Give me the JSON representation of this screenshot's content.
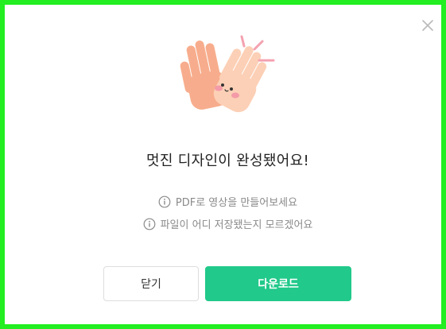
{
  "dialog": {
    "title": "멋진 디자인이 완성됐어요!",
    "tips": [
      "PDF로 영상을 만들어보세요",
      "파일이 어디 저장됐는지 모르겠어요"
    ],
    "buttons": {
      "close_label": "닫기",
      "download_label": "다운로드"
    },
    "icons": {
      "close": "close-icon",
      "illustration": "high-five-hands-illustration",
      "tip": "info-icon"
    },
    "colors": {
      "frame_border": "#22ee22",
      "primary": "#21c98a",
      "hand_back": "#f7ad8d",
      "hand_front": "#fcd0b6",
      "blush": "#f49aa8",
      "sparkle": "#f4a1b0"
    }
  }
}
